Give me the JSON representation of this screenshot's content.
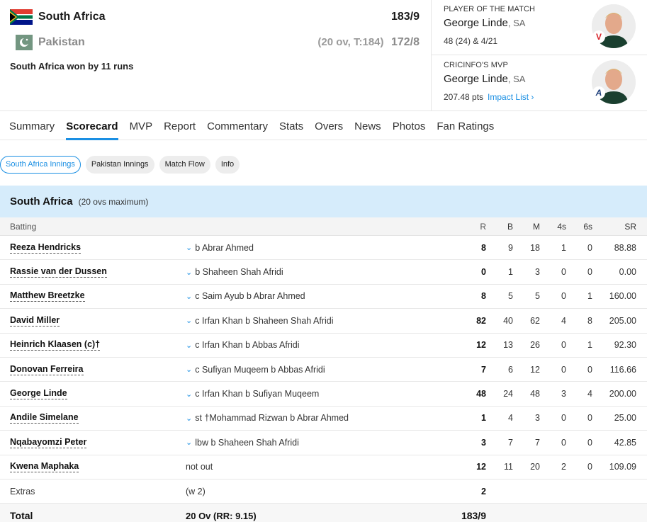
{
  "match": {
    "team1": {
      "name": "South Africa",
      "score": "183/9",
      "flag": "south-africa-flag"
    },
    "team2": {
      "name": "Pakistan",
      "meta": "(20 ov, T:184)",
      "score": "172/8",
      "flag": "pakistan-flag"
    },
    "result": "South Africa won by 11 runs"
  },
  "awards": {
    "potm": {
      "kicker": "PLAYER OF THE MATCH",
      "name": "George Linde",
      "team": ", SA",
      "stat": "48 (24) & 4/21",
      "badge": "V"
    },
    "mvp": {
      "kicker": "CRICINFO'S MVP",
      "name": "George Linde",
      "team": ", SA",
      "stat": "207.48 pts",
      "link": "Impact List ›",
      "badge": "A"
    }
  },
  "tabs": [
    "Summary",
    "Scorecard",
    "MVP",
    "Report",
    "Commentary",
    "Stats",
    "Overs",
    "News",
    "Photos",
    "Fan Ratings"
  ],
  "active_tab": "Scorecard",
  "pills": [
    "South Africa Innings",
    "Pakistan Innings",
    "Match Flow",
    "Info"
  ],
  "innings": {
    "title": "South Africa",
    "subtitle": "(20 ovs maximum)"
  },
  "batting": {
    "headers": {
      "batting": "Batting",
      "r": "R",
      "b": "B",
      "m": "M",
      "fours": "4s",
      "sixes": "6s",
      "sr": "SR"
    },
    "rows": [
      {
        "name": "Reeza Hendricks",
        "dismissal": "b Abrar Ahmed",
        "r": "8",
        "b": "9",
        "m": "18",
        "fours": "1",
        "sixes": "0",
        "sr": "88.88"
      },
      {
        "name": "Rassie van der Dussen",
        "dismissal": "b Shaheen Shah Afridi",
        "r": "0",
        "b": "1",
        "m": "3",
        "fours": "0",
        "sixes": "0",
        "sr": "0.00"
      },
      {
        "name": "Matthew Breetzke",
        "dismissal": "c Saim Ayub b Abrar Ahmed",
        "r": "8",
        "b": "5",
        "m": "5",
        "fours": "0",
        "sixes": "1",
        "sr": "160.00"
      },
      {
        "name": "David Miller",
        "dismissal": "c Irfan Khan b Shaheen Shah Afridi",
        "r": "82",
        "b": "40",
        "m": "62",
        "fours": "4",
        "sixes": "8",
        "sr": "205.00"
      },
      {
        "name": "Heinrich Klaasen (c)†",
        "dismissal": "c Irfan Khan b Abbas Afridi",
        "r": "12",
        "b": "13",
        "m": "26",
        "fours": "0",
        "sixes": "1",
        "sr": "92.30"
      },
      {
        "name": "Donovan Ferreira",
        "dismissal": "c Sufiyan Muqeem b Abbas Afridi",
        "r": "7",
        "b": "6",
        "m": "12",
        "fours": "0",
        "sixes": "0",
        "sr": "116.66"
      },
      {
        "name": "George Linde",
        "dismissal": "c Irfan Khan b Sufiyan Muqeem",
        "r": "48",
        "b": "24",
        "m": "48",
        "fours": "3",
        "sixes": "4",
        "sr": "200.00"
      },
      {
        "name": "Andile Simelane",
        "dismissal": "st †Mohammad Rizwan b Abrar Ahmed",
        "r": "1",
        "b": "4",
        "m": "3",
        "fours": "0",
        "sixes": "0",
        "sr": "25.00"
      },
      {
        "name": "Nqabayomzi Peter",
        "dismissal": "lbw b Shaheen Shah Afridi",
        "r": "3",
        "b": "7",
        "m": "7",
        "fours": "0",
        "sixes": "0",
        "sr": "42.85"
      },
      {
        "name": "Kwena Maphaka",
        "dismissal": "not out",
        "r": "12",
        "b": "11",
        "m": "20",
        "fours": "2",
        "sixes": "0",
        "sr": "109.09",
        "not_out": true
      }
    ],
    "extras": {
      "label": "Extras",
      "detail": "(w 2)",
      "value": "2"
    },
    "total": {
      "label": "Total",
      "detail": "20 Ov (RR: 9.15)",
      "value": "183/9"
    }
  },
  "colors": {
    "accent": "#1a8fe3",
    "innings_band": "#d6ecfb"
  }
}
